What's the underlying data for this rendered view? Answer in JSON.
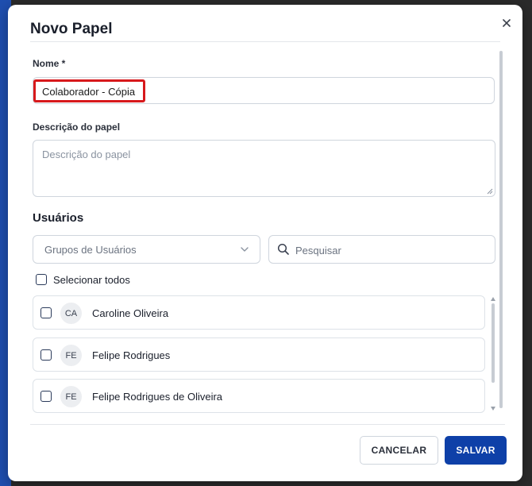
{
  "modal": {
    "title": "Novo Papel",
    "close_icon": "close-icon"
  },
  "form": {
    "name_label": "Nome *",
    "name_value": "Colaborador - Cópia",
    "description_label": "Descrição do papel",
    "description_placeholder": "Descrição do papel",
    "description_value": ""
  },
  "users": {
    "section_title": "Usuários",
    "groups_placeholder": "Grupos de Usuários",
    "search_placeholder": "Pesquisar",
    "select_all_label": "Selecionar todos",
    "select_all_checked": false,
    "items": [
      {
        "initials": "CA",
        "name": "Caroline Oliveira",
        "checked": false
      },
      {
        "initials": "FE",
        "name": "Felipe Rodrigues",
        "checked": false
      },
      {
        "initials": "FE",
        "name": "Felipe Rodrigues de Oliveira",
        "checked": false
      }
    ]
  },
  "footer": {
    "cancel_label": "CANCELAR",
    "save_label": "SALVAR"
  },
  "colors": {
    "primary": "#0e40a8",
    "highlight": "#d7191c"
  }
}
